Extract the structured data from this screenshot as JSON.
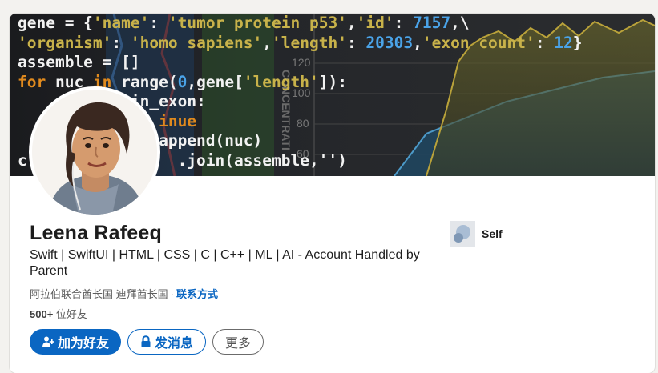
{
  "banner": {
    "code_lines": [
      [
        {
          "t": "gene = {",
          "c": "txt"
        },
        {
          "t": "'name'",
          "c": "str"
        },
        {
          "t": ": ",
          "c": "txt"
        },
        {
          "t": "'tumor protein p53'",
          "c": "str"
        },
        {
          "t": ",",
          "c": "txt"
        },
        {
          "t": "'id'",
          "c": "str"
        },
        {
          "t": ": ",
          "c": "txt"
        },
        {
          "t": "7157",
          "c": "num"
        },
        {
          "t": ",\\",
          "c": "txt"
        }
      ],
      [
        {
          "t": "'organism'",
          "c": "str"
        },
        {
          "t": ": ",
          "c": "txt"
        },
        {
          "t": "'homo sapiens'",
          "c": "str"
        },
        {
          "t": ",",
          "c": "txt"
        },
        {
          "t": "'length'",
          "c": "str"
        },
        {
          "t": ": ",
          "c": "txt"
        },
        {
          "t": "20303",
          "c": "num"
        },
        {
          "t": ",",
          "c": "txt"
        },
        {
          "t": "'exon count'",
          "c": "str"
        },
        {
          "t": ": ",
          "c": "txt"
        },
        {
          "t": "12",
          "c": "num"
        },
        {
          "t": "}",
          "c": "txt"
        }
      ],
      [
        {
          "t": "assemble = []",
          "c": "txt"
        }
      ],
      [
        {
          "t": "for ",
          "c": "kw"
        },
        {
          "t": "nuc ",
          "c": "txt"
        },
        {
          "t": "in ",
          "c": "kw"
        },
        {
          "t": "range(",
          "c": "txt"
        },
        {
          "t": "0",
          "c": "num"
        },
        {
          "t": ",gene[",
          "c": "txt"
        },
        {
          "t": "'length'",
          "c": "str"
        },
        {
          "t": "]):",
          "c": "txt"
        }
      ],
      [
        {
          "t": "            in_exon:",
          "c": "txt"
        }
      ],
      [
        {
          "t": "               inue",
          "c": "kw"
        }
      ],
      [
        {
          "t": "               append(nuc)",
          "c": "txt"
        }
      ],
      [
        {
          "t": "c                .join(assemble,'')",
          "c": "txt"
        }
      ]
    ],
    "graph_ticks": [
      "120",
      "100",
      "80",
      "60"
    ],
    "graph_axis_label": "CONCENTRATI"
  },
  "profile": {
    "name": "Leena Rafeeq",
    "headline": "Swift | SwiftUI | HTML | CSS | C | C++ | ML | AI - Account Handled by Parent",
    "location": "阿拉伯联合酋长国 迪拜酋长国",
    "location_separator": "·",
    "contact_link": "联系方式",
    "connections_count": "500+",
    "connections_label": " 位好友"
  },
  "company": {
    "name": "Self"
  },
  "actions": {
    "connect": "加为好友",
    "message": "发消息",
    "more": "更多"
  },
  "colors": {
    "accent": "#0a66c2",
    "code_string": "#c8b24a",
    "code_number": "#4aa3e8",
    "code_keyword": "#e08a1e"
  }
}
